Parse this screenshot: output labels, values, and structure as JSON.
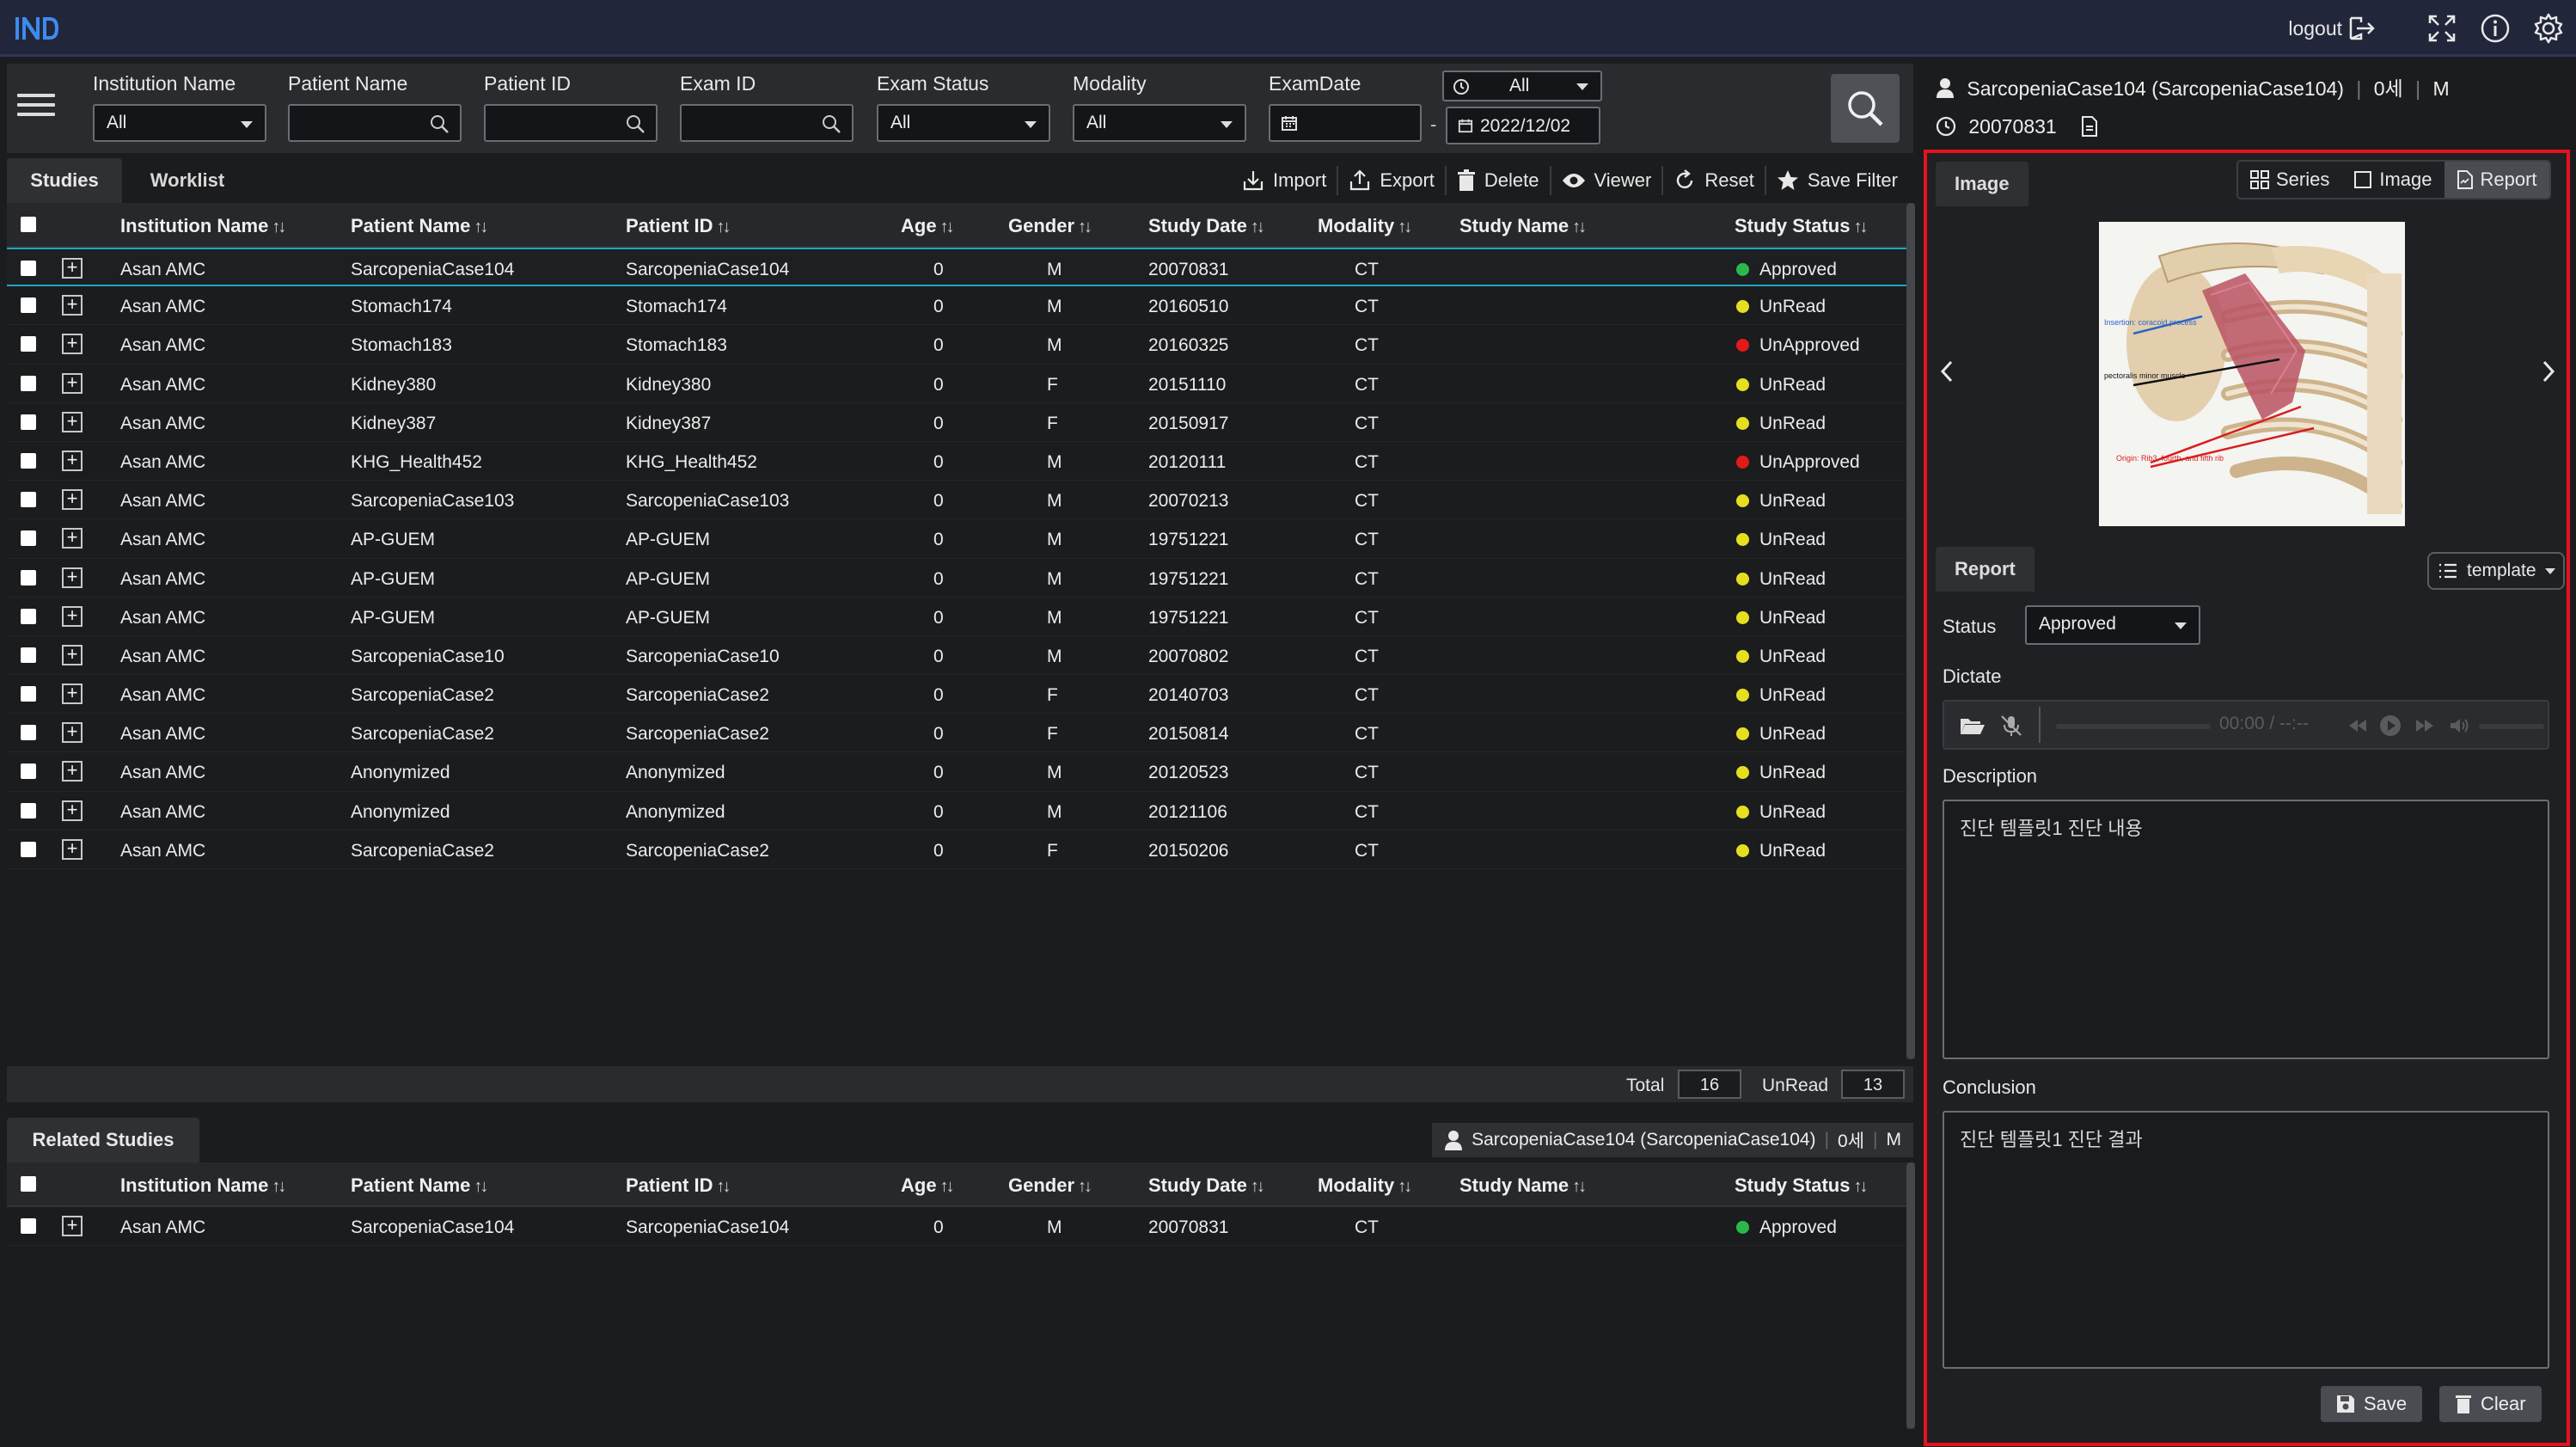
{
  "app": {
    "logout_label": "logout"
  },
  "filters": {
    "institution": {
      "label": "Institution Name",
      "value": "All"
    },
    "patient_name": {
      "label": "Patient Name",
      "value": ""
    },
    "patient_id": {
      "label": "Patient ID",
      "value": ""
    },
    "exam_id": {
      "label": "Exam ID",
      "value": ""
    },
    "exam_status": {
      "label": "Exam Status",
      "value": "All"
    },
    "modality": {
      "label": "Modality",
      "value": "All"
    },
    "exam_date": {
      "label": "ExamDate",
      "range": "All",
      "from": "",
      "separator": "-",
      "to": "2022/12/02"
    }
  },
  "tabs": {
    "studies": "Studies",
    "worklist": "Worklist"
  },
  "toolbar": {
    "import": "Import",
    "export": "Export",
    "delete": "Delete",
    "viewer": "Viewer",
    "reset": "Reset",
    "save_filter": "Save Filter"
  },
  "columns": [
    "Institution Name",
    "Patient Name",
    "Patient ID",
    "Age",
    "Gender",
    "Study Date",
    "Modality",
    "Study Name",
    "Study Status"
  ],
  "status_colors": {
    "Approved": "#2bb84a",
    "UnRead": "#e6df1f",
    "UnApproved": "#e21a1a"
  },
  "studies": [
    {
      "inst": "Asan AMC",
      "name": "SarcopeniaCase104",
      "pid": "SarcopeniaCase104",
      "age": "0",
      "gender": "M",
      "date": "20070831",
      "mod": "CT",
      "study": "",
      "status": "Approved"
    },
    {
      "inst": "Asan AMC",
      "name": "Stomach174",
      "pid": "Stomach174",
      "age": "0",
      "gender": "M",
      "date": "20160510",
      "mod": "CT",
      "study": "",
      "status": "UnRead"
    },
    {
      "inst": "Asan AMC",
      "name": "Stomach183",
      "pid": "Stomach183",
      "age": "0",
      "gender": "M",
      "date": "20160325",
      "mod": "CT",
      "study": "",
      "status": "UnApproved"
    },
    {
      "inst": "Asan AMC",
      "name": "Kidney380",
      "pid": "Kidney380",
      "age": "0",
      "gender": "F",
      "date": "20151110",
      "mod": "CT",
      "study": "",
      "status": "UnRead"
    },
    {
      "inst": "Asan AMC",
      "name": "Kidney387",
      "pid": "Kidney387",
      "age": "0",
      "gender": "F",
      "date": "20150917",
      "mod": "CT",
      "study": "",
      "status": "UnRead"
    },
    {
      "inst": "Asan AMC",
      "name": "KHG_Health452",
      "pid": "KHG_Health452",
      "age": "0",
      "gender": "M",
      "date": "20120111",
      "mod": "CT",
      "study": "",
      "status": "UnApproved"
    },
    {
      "inst": "Asan AMC",
      "name": "SarcopeniaCase103",
      "pid": "SarcopeniaCase103",
      "age": "0",
      "gender": "M",
      "date": "20070213",
      "mod": "CT",
      "study": "",
      "status": "UnRead"
    },
    {
      "inst": "Asan AMC",
      "name": "AP-GUEM",
      "pid": "AP-GUEM",
      "age": "0",
      "gender": "M",
      "date": "19751221",
      "mod": "CT",
      "study": "",
      "status": "UnRead"
    },
    {
      "inst": "Asan AMC",
      "name": "AP-GUEM",
      "pid": "AP-GUEM",
      "age": "0",
      "gender": "M",
      "date": "19751221",
      "mod": "CT",
      "study": "",
      "status": "UnRead"
    },
    {
      "inst": "Asan AMC",
      "name": "AP-GUEM",
      "pid": "AP-GUEM",
      "age": "0",
      "gender": "M",
      "date": "19751221",
      "mod": "CT",
      "study": "",
      "status": "UnRead"
    },
    {
      "inst": "Asan AMC",
      "name": "SarcopeniaCase10",
      "pid": "SarcopeniaCase10",
      "age": "0",
      "gender": "M",
      "date": "20070802",
      "mod": "CT",
      "study": "",
      "status": "UnRead"
    },
    {
      "inst": "Asan AMC",
      "name": "SarcopeniaCase2",
      "pid": "SarcopeniaCase2",
      "age": "0",
      "gender": "F",
      "date": "20140703",
      "mod": "CT",
      "study": "",
      "status": "UnRead"
    },
    {
      "inst": "Asan AMC",
      "name": "SarcopeniaCase2",
      "pid": "SarcopeniaCase2",
      "age": "0",
      "gender": "F",
      "date": "20150814",
      "mod": "CT",
      "study": "",
      "status": "UnRead"
    },
    {
      "inst": "Asan AMC",
      "name": "Anonymized",
      "pid": "Anonymized",
      "age": "0",
      "gender": "M",
      "date": "20120523",
      "mod": "CT",
      "study": "",
      "status": "UnRead"
    },
    {
      "inst": "Asan AMC",
      "name": "Anonymized",
      "pid": "Anonymized",
      "age": "0",
      "gender": "M",
      "date": "20121106",
      "mod": "CT",
      "study": "",
      "status": "UnRead"
    },
    {
      "inst": "Asan AMC",
      "name": "SarcopeniaCase2",
      "pid": "SarcopeniaCase2",
      "age": "0",
      "gender": "F",
      "date": "20150206",
      "mod": "CT",
      "study": "",
      "status": "UnRead"
    }
  ],
  "footer": {
    "total_label": "Total",
    "total": "16",
    "unread_label": "UnRead",
    "unread": "13"
  },
  "related": {
    "tab": "Related Studies",
    "patient": "SarcopeniaCase104 (SarcopeniaCase104)",
    "age": "0세",
    "sex": "M",
    "rows": [
      {
        "inst": "Asan AMC",
        "name": "SarcopeniaCase104",
        "pid": "SarcopeniaCase104",
        "age": "0",
        "gender": "M",
        "date": "20070831",
        "mod": "CT",
        "study": "",
        "status": "Approved"
      }
    ]
  },
  "panel": {
    "patient": "SarcopeniaCase104 (SarcopeniaCase104)",
    "age": "0세",
    "sex": "M",
    "date": "20070831",
    "image_tab": "Image",
    "series_btn": "Series",
    "image_btn": "Image",
    "report_btn": "Report",
    "image_labels": {
      "insertion": "Insertion: coracoid process",
      "muscle": "pectoralis minor muscle",
      "origin": "Origin: Rib3, fourth, and fifth rib"
    },
    "report_tab": "Report",
    "template_btn": "template",
    "status_label": "Status",
    "status_value": "Approved",
    "dictate_label": "Dictate",
    "audio_time": "00:00 / --:--",
    "description_label": "Description",
    "description": "진단 템플릿1 진단 내용",
    "conclusion_label": "Conclusion",
    "conclusion": "진단 템플릿1 진단 결과",
    "save_btn": "Save",
    "clear_btn": "Clear"
  },
  "colors": {
    "accent": "#21a3c2",
    "highlight_border": "#e3131e",
    "topbar": "#22263a"
  }
}
